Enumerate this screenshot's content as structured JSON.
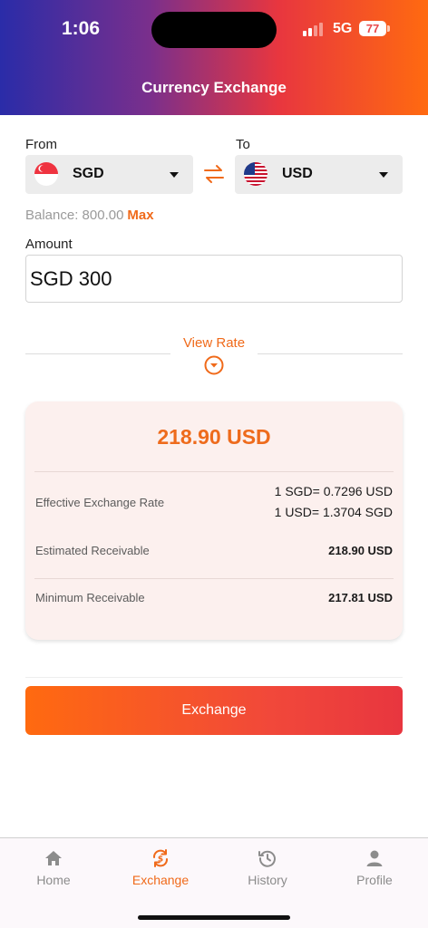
{
  "status_bar": {
    "time": "1:06",
    "network": "5G",
    "battery": "77"
  },
  "header": {
    "title": "Currency Exchange"
  },
  "from": {
    "label": "From",
    "currency": "SGD",
    "flag_icon": "singapore-flag-icon"
  },
  "to": {
    "label": "To",
    "currency": "USD",
    "flag_icon": "usa-flag-icon"
  },
  "balance": {
    "text": "Balance: 800.00",
    "max_label": "Max"
  },
  "amount": {
    "label": "Amount",
    "value": "SGD 300"
  },
  "view_rate": {
    "label": "View Rate"
  },
  "summary": {
    "total": "218.90 USD",
    "effective_rate_label": "Effective Exchange Rate",
    "effective_rate_line1": "1 SGD= 0.7296 USD",
    "effective_rate_line2": "1 USD= 1.3704 SGD",
    "estimated_label": "Estimated Receivable",
    "estimated_value": "218.90 USD",
    "minimum_label": "Minimum Receivable",
    "minimum_value": "217.81 USD"
  },
  "action": {
    "exchange_label": "Exchange"
  },
  "tabs": [
    {
      "label": "Home",
      "icon": "home-icon",
      "active": false
    },
    {
      "label": "Exchange",
      "icon": "exchange-icon",
      "active": true
    },
    {
      "label": "History",
      "icon": "history-icon",
      "active": false
    },
    {
      "label": "Profile",
      "icon": "profile-icon",
      "active": false
    }
  ],
  "colors": {
    "accent": "#f06a1a",
    "tab_inactive": "#8c8c8c",
    "card_bg": "#fcf0ee"
  }
}
